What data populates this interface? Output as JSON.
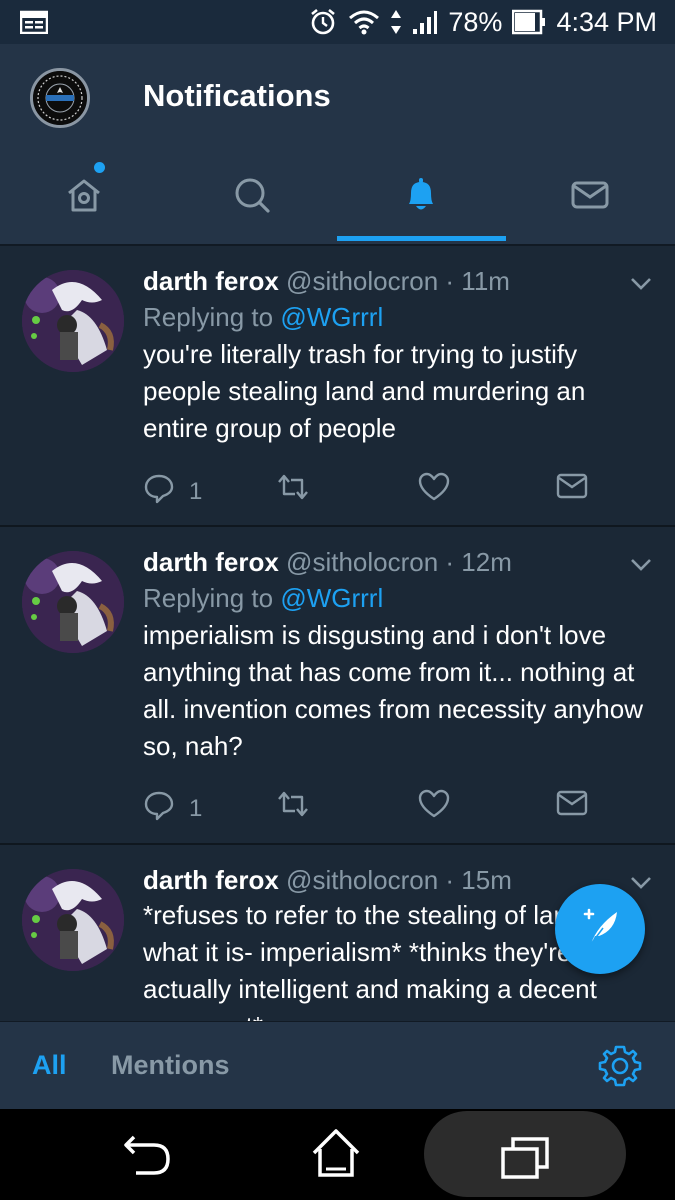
{
  "status_bar": {
    "battery": "78%",
    "time": "4:34 PM"
  },
  "header": {
    "title": "Notifications"
  },
  "tabs": [
    {
      "icon": "home-icon",
      "active": false,
      "has_dot": true
    },
    {
      "icon": "search-icon",
      "active": false
    },
    {
      "icon": "bell-icon",
      "active": true
    },
    {
      "icon": "mail-icon",
      "active": false
    }
  ],
  "tweets": [
    {
      "name": "darth ferox",
      "handle": "@sitholocron",
      "time": "· 11m",
      "replying_to_prefix": "Replying to",
      "replying_to": "@WGrrrl",
      "text": "you're literally trash for trying to justify people stealing land and murdering an entire group of people",
      "reply_count": "1"
    },
    {
      "name": "darth ferox",
      "handle": "@sitholocron",
      "time": "· 12m",
      "replying_to_prefix": "Replying to",
      "replying_to": "@WGrrrl",
      "text": "imperialism is disgusting and i don't love anything that has come from it... nothing at all. invention comes from necessity anyhow so, nah?",
      "reply_count": "1"
    },
    {
      "name": "darth ferox",
      "handle": "@sitholocron",
      "time": "· 15m",
      "text": "*refuses to refer to the stealing of land as what it is- imperialism* *thinks they're actually intelligent and making a decent argument*"
    }
  ],
  "filter_bar": {
    "all_label": "All",
    "mentions_label": "Mentions"
  },
  "colors": {
    "accent": "#1da1f2",
    "background": "#1b2836",
    "header": "#243447",
    "muted_text": "#8899a6"
  }
}
